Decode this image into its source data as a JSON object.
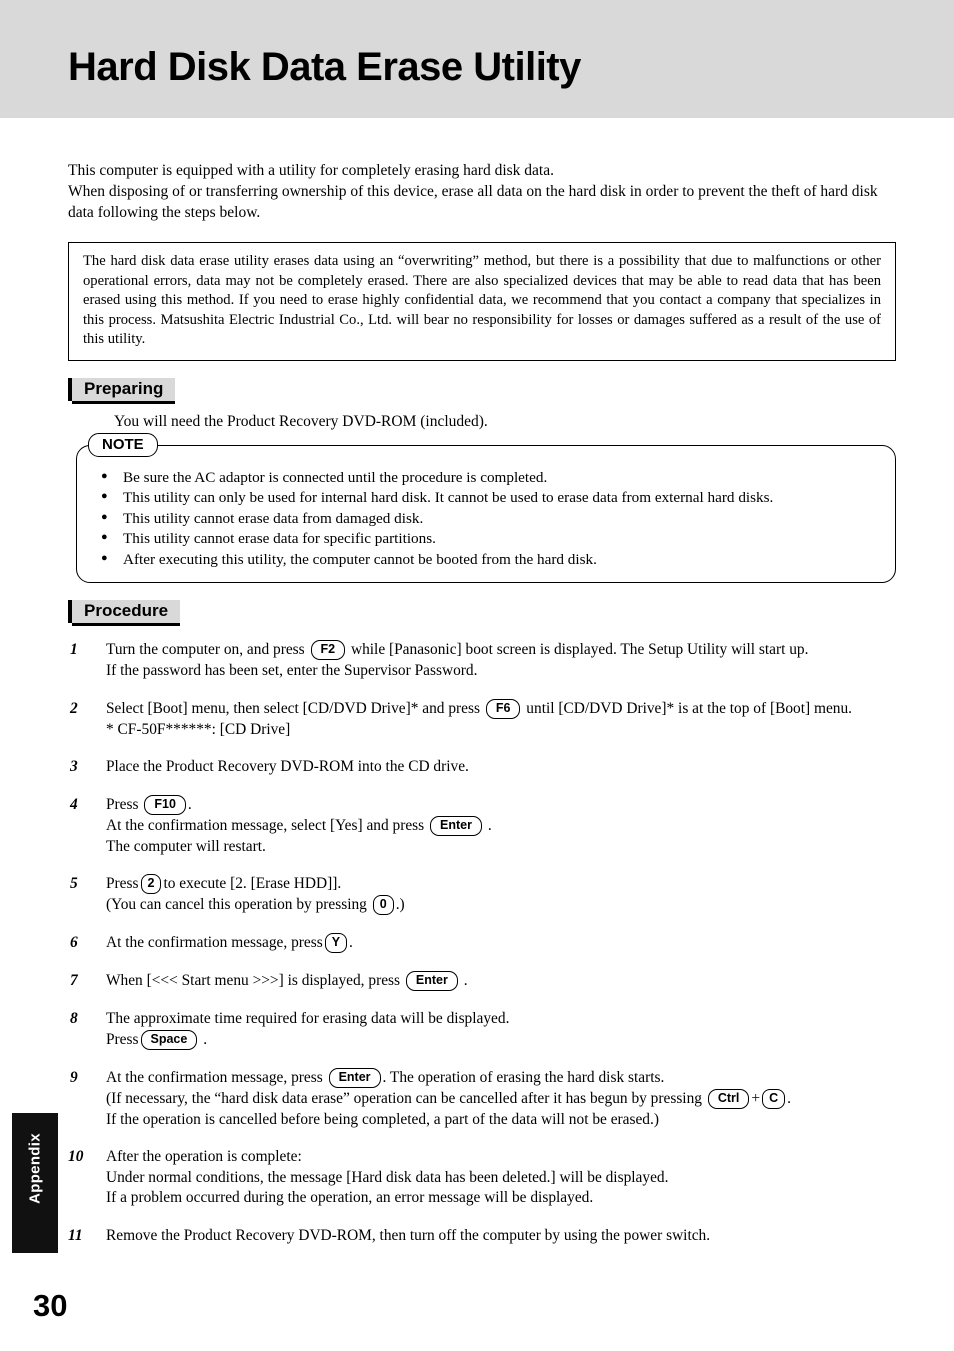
{
  "header": {
    "title": "Hard Disk Data Erase Utility"
  },
  "side_tab": {
    "label": "Appendix"
  },
  "page_number": "30",
  "intro": {
    "line1": "This computer is equipped with a utility for completely erasing hard disk data.",
    "line2": "When disposing of or transferring ownership of this device, erase all data on the hard disk in order to prevent the theft of hard disk",
    "line3": "data following the steps below."
  },
  "warning": {
    "text": "The hard disk data erase utility erases data using an “overwriting” method, but there is a possibility that due to malfunctions or other operational errors, data may not be completely erased. There are also specialized devices that may be able to read data that has been erased using this method. If you need to erase highly confidential data, we recommend that you contact a company that specializes in this process. Matsushita Electric Industrial Co., Ltd. will bear no responsibility for losses or damages suffered as a result of the use of this utility."
  },
  "preparing": {
    "heading": "Preparing",
    "text": "You will need the Product Recovery DVD-ROM (included)."
  },
  "note": {
    "tag": "NOTE",
    "items": [
      "Be sure the AC adaptor is connected until the procedure is completed.",
      "This utility can only be used for internal hard disk.  It cannot be used to erase data from external hard disks.",
      "This utility cannot erase data from damaged disk.",
      "This utility cannot erase data for specific partitions.",
      "After executing this utility, the computer cannot be booted from the hard disk."
    ]
  },
  "procedure": {
    "heading": "Procedure",
    "steps": {
      "s1": {
        "num": "1",
        "a1": "Turn the computer on, and press",
        "key1": "F2",
        "a2": "while [Panasonic] boot screen is displayed. The Setup Utility will start up.",
        "b1": "If the password has been set, enter the Supervisor Password."
      },
      "s2": {
        "num": "2",
        "a1": "Select [Boot] menu, then select [CD/DVD Drive]* and press",
        "key1": "F6",
        "a2": "until [CD/DVD Drive]* is at the top of [Boot] menu.",
        "b1": "* CF-50F******: [CD Drive]"
      },
      "s3": {
        "num": "3",
        "a1": "Place the Product Recovery DVD-ROM into the CD drive."
      },
      "s4": {
        "num": "4",
        "a1": "Press",
        "key1": "F10",
        "a2": ".",
        "b1": "At the confirmation message, select [Yes] and press",
        "key2": "Enter",
        "b2": ".",
        "c1": "The computer will restart."
      },
      "s5": {
        "num": "5",
        "a1": "Press",
        "key1": "2",
        "a2": "to execute [2. [Erase HDD]].",
        "b1": "(You can cancel this operation by pressing",
        "key2": "0",
        "b2": ".)"
      },
      "s6": {
        "num": "6",
        "a1": "At the confirmation message, press",
        "key1": "Y",
        "a2": "."
      },
      "s7": {
        "num": "7",
        "a1": "When [<<< Start menu >>>] is displayed, press",
        "key1": "Enter",
        "a2": "."
      },
      "s8": {
        "num": "8",
        "a1": "The approximate time required for erasing data will be displayed.",
        "b1": "Press",
        "key1": "Space",
        "b2": "."
      },
      "s9": {
        "num": "9",
        "a1": "At the confirmation message, press",
        "key1": "Enter",
        "a2": ". The operation of erasing the hard disk starts.",
        "b1": "(If necessary, the “hard disk data erase” operation can be cancelled after it has begun by pressing",
        "key2": "Ctrl",
        "b2": "+",
        "key3": "C",
        "b3": ".",
        "c1": "If the operation is cancelled before being completed, a part of the data will not be erased.)"
      },
      "s10": {
        "num": "10",
        "a1": "After the operation is complete:",
        "b1": "Under normal conditions, the message [Hard disk data has been deleted.] will be displayed.",
        "c1": "If a problem occurred during the operation, an error message will be displayed."
      },
      "s11": {
        "num": "11",
        "a1": "Remove the Product Recovery DVD-ROM, then turn off the computer by using the power switch."
      }
    }
  }
}
